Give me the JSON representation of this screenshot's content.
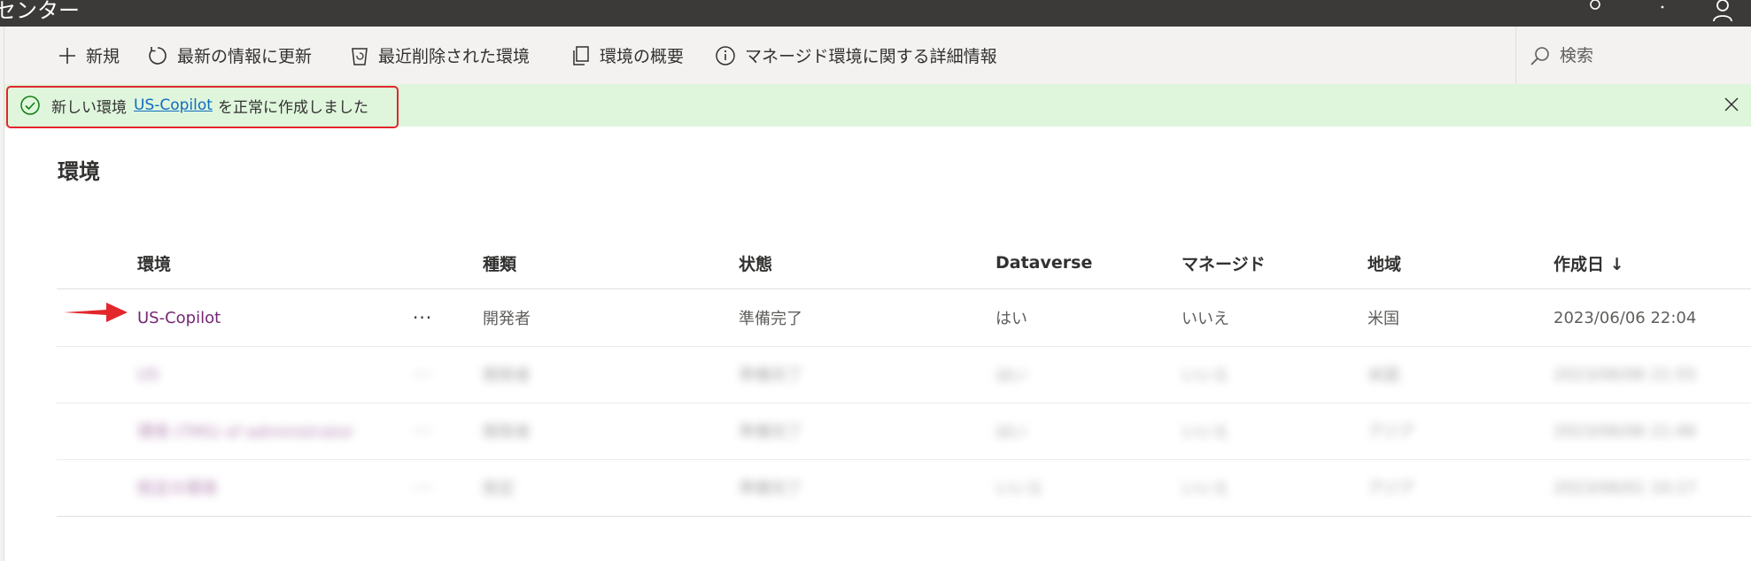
{
  "header": {
    "app_title": "センター"
  },
  "commands": {
    "new": "新規",
    "refresh": "最新の情報に更新",
    "recently_deleted": "最近削除された環境",
    "overview": "環境の概要",
    "managed_info": "マネージド環境に関する詳細情報"
  },
  "search": {
    "placeholder": "検索"
  },
  "banner": {
    "before": "新しい環境",
    "link": "US-Copilot",
    "after": "を正常に作成しました",
    "color": "#dff6dd"
  },
  "page": {
    "title": "環境"
  },
  "table": {
    "headers": {
      "name": "環境",
      "type": "種類",
      "state": "状態",
      "dataverse": "Dataverse",
      "managed": "マネージド",
      "region": "地域",
      "created": "作成日 ↓"
    },
    "rows": [
      {
        "name": "US-Copilot",
        "more": "···",
        "type": "開発者",
        "state": "準備完了",
        "dataverse": "はい",
        "managed": "いいえ",
        "region": "米国",
        "created": "2023/06/06 22:04"
      },
      {
        "name": "US",
        "more": "···",
        "type": "開発者",
        "state": "準備完了",
        "dataverse": "はい",
        "managed": "いいえ",
        "region": "米国",
        "created": "2023/06/06 21:55"
      },
      {
        "name": "環境 (TMS) of administrator",
        "more": "···",
        "type": "開発者",
        "state": "準備完了",
        "dataverse": "はい",
        "managed": "いいえ",
        "region": "アジア",
        "created": "2023/06/06 21:46"
      },
      {
        "name": "既定の環境",
        "more": "···",
        "type": "既定",
        "state": "準備完了",
        "dataverse": "いいえ",
        "managed": "いいえ",
        "region": "アジア",
        "created": "2023/06/01 10:17"
      }
    ]
  },
  "colors": {
    "accent": "#742774",
    "link": "#0f6cbd",
    "header_bg": "#3b3a39",
    "annotation_red": "#e3262b"
  }
}
